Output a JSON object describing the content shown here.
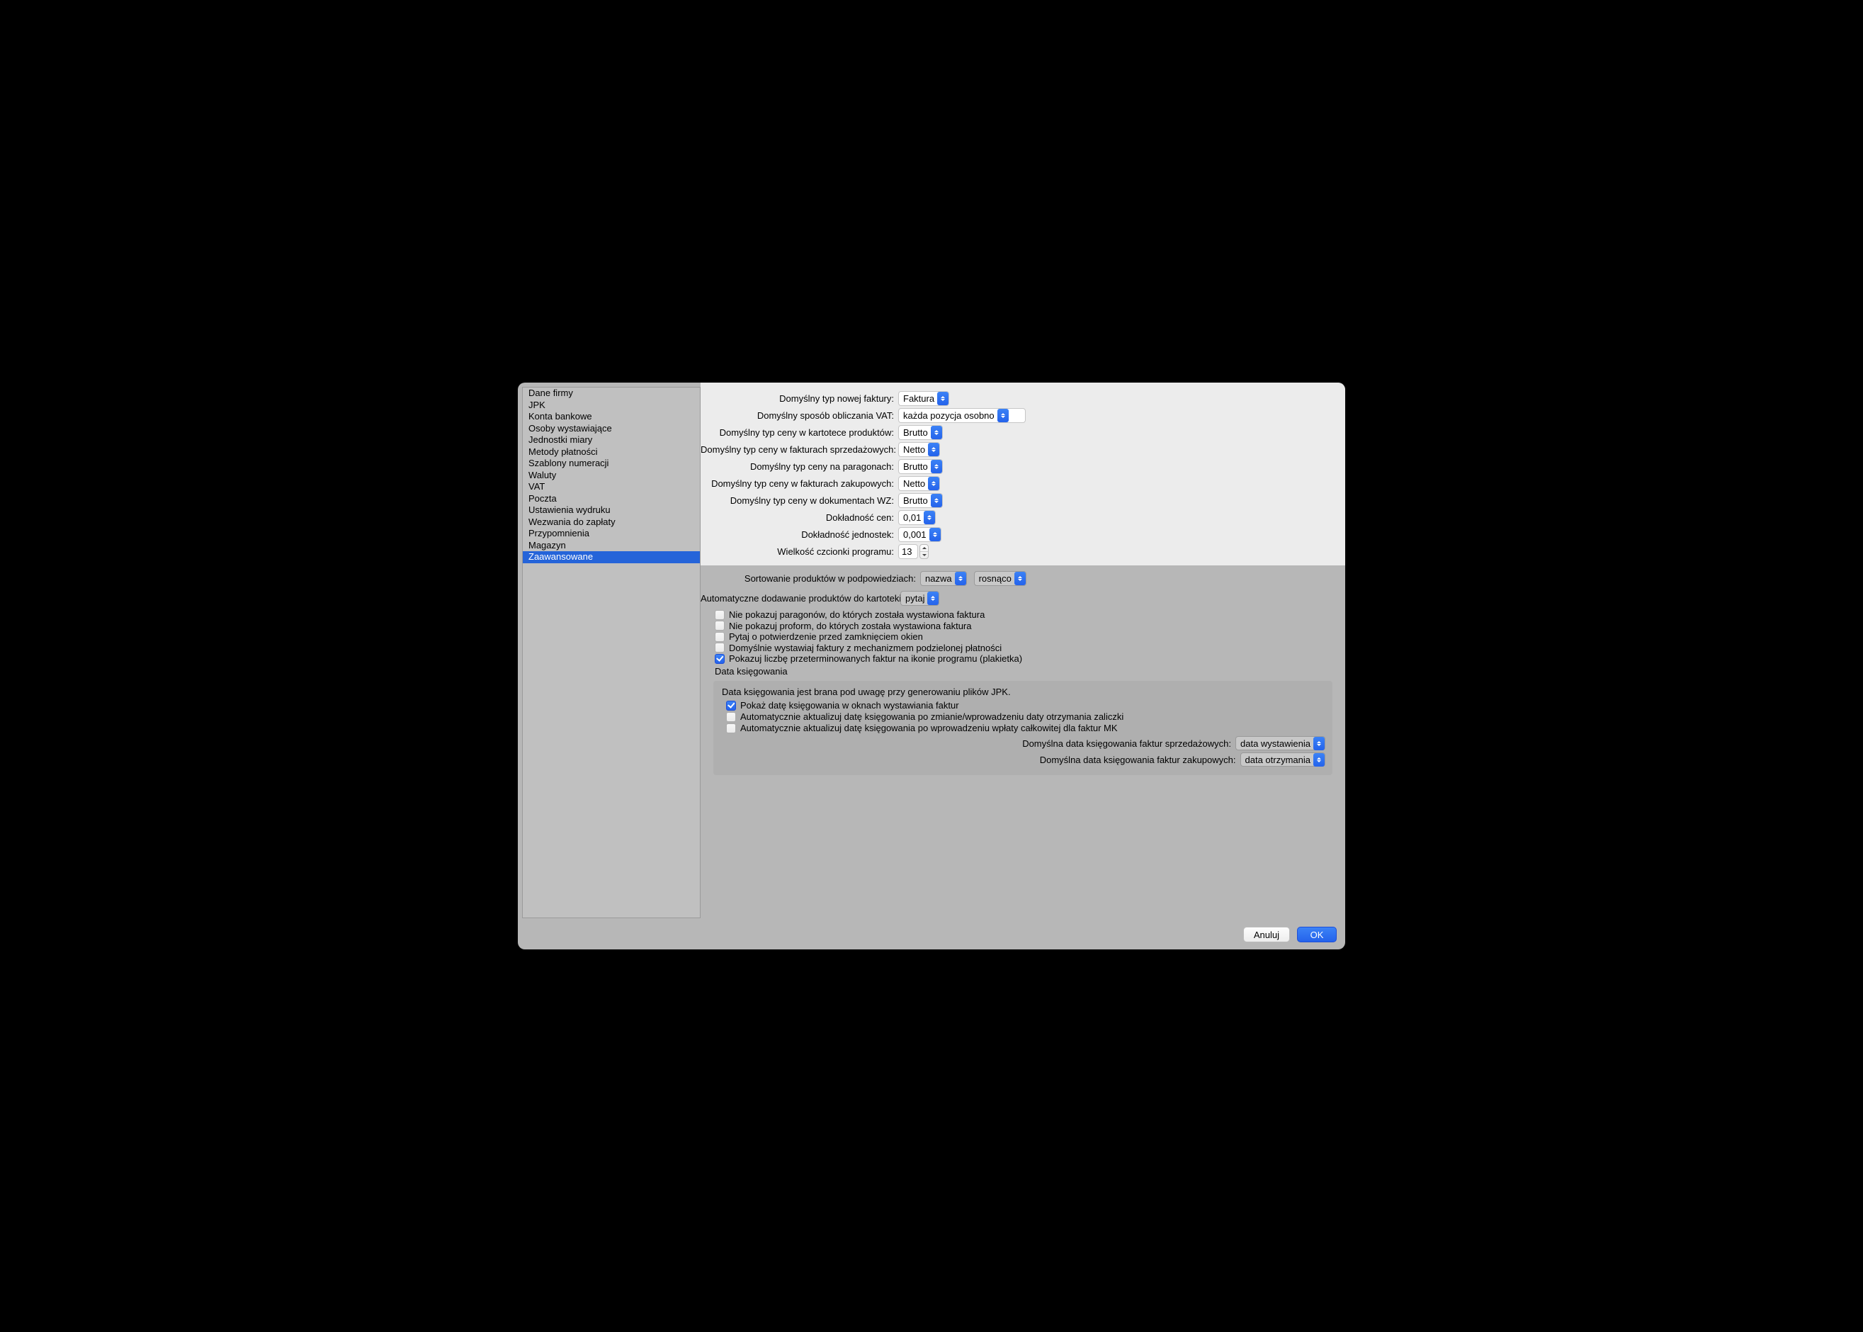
{
  "sidebar": {
    "items": [
      {
        "label": "Dane firmy"
      },
      {
        "label": "JPK"
      },
      {
        "label": "Konta bankowe"
      },
      {
        "label": "Osoby wystawiające"
      },
      {
        "label": "Jednostki miary"
      },
      {
        "label": "Metody płatności"
      },
      {
        "label": "Szablony numeracji"
      },
      {
        "label": "Waluty"
      },
      {
        "label": "VAT"
      },
      {
        "label": "Poczta"
      },
      {
        "label": "Ustawienia wydruku"
      },
      {
        "label": "Wezwania do zapłaty"
      },
      {
        "label": "Przypomnienia"
      },
      {
        "label": "Magazyn"
      },
      {
        "label": "Zaawansowane"
      }
    ],
    "selected_index": 14
  },
  "form": {
    "default_new_invoice_type": {
      "label": "Domyślny typ nowej faktury:",
      "value": "Faktura"
    },
    "default_vat_calc": {
      "label": "Domyślny sposób obliczania VAT:",
      "value": "każda pozycja osobno"
    },
    "default_price_products": {
      "label": "Domyślny typ ceny w kartotece produktów:",
      "value": "Brutto"
    },
    "default_price_sales": {
      "label": "Domyślny typ ceny w fakturach sprzedażowych:",
      "value": "Netto"
    },
    "default_price_receipts": {
      "label": "Domyślny typ ceny na paragonach:",
      "value": "Brutto"
    },
    "default_price_purchase": {
      "label": "Domyślny typ ceny w fakturach zakupowych:",
      "value": "Netto"
    },
    "default_price_wz": {
      "label": "Domyślny typ ceny w dokumentach WZ:",
      "value": "Brutto"
    },
    "price_precision": {
      "label": "Dokładność cen:",
      "value": "0,01"
    },
    "unit_precision": {
      "label": "Dokładność jednostek:",
      "value": "0,001"
    },
    "font_size": {
      "label": "Wielkość czcionki programu:",
      "value": "13"
    },
    "product_sort": {
      "label": "Sortowanie produktów w podpowiedziach:",
      "value1": "nazwa",
      "value2": "rosnąco"
    },
    "auto_add_products": {
      "label": "Automatyczne dodawanie produktów do kartoteki:",
      "value": "pytaj"
    }
  },
  "checkboxes": {
    "hide_receipts": {
      "checked": false,
      "label": "Nie pokazuj paragonów, do których została wystawiona faktura"
    },
    "hide_proformas": {
      "checked": false,
      "label": "Nie pokazuj proform, do których została wystawiona faktura"
    },
    "confirm_close": {
      "checked": false,
      "label": "Pytaj o potwierdzenie przed zamknięciem okien"
    },
    "split_payment": {
      "checked": false,
      "label": "Domyślnie wystawiaj faktury z mechanizmem podzielonej płatności"
    },
    "show_overdue_badge": {
      "checked": true,
      "label": "Pokazuj liczbę przeterminowanych faktur na ikonie programu (plakietka)"
    }
  },
  "booking": {
    "heading": "Data księgowania",
    "note": "Data księgowania jest brana pod uwagę przy generowaniu plików JPK.",
    "show_date": {
      "checked": true,
      "label": "Pokaż datę księgowania w oknach wystawiania faktur"
    },
    "auto_update_advance": {
      "checked": false,
      "label": "Automatycznie aktualizuj datę księgowania po zmianie/wprowadzeniu daty otrzymania zaliczki"
    },
    "auto_update_full": {
      "checked": false,
      "label": "Automatycznie aktualizuj datę księgowania po wprowadzeniu wpłaty całkowitej dla faktur MK"
    },
    "default_sales": {
      "label": "Domyślna data księgowania faktur sprzedażowych:",
      "value": "data wystawienia"
    },
    "default_purchase": {
      "label": "Domyślna data księgowania faktur zakupowych:",
      "value": "data otrzymania"
    }
  },
  "buttons": {
    "cancel": "Anuluj",
    "ok": "OK"
  }
}
